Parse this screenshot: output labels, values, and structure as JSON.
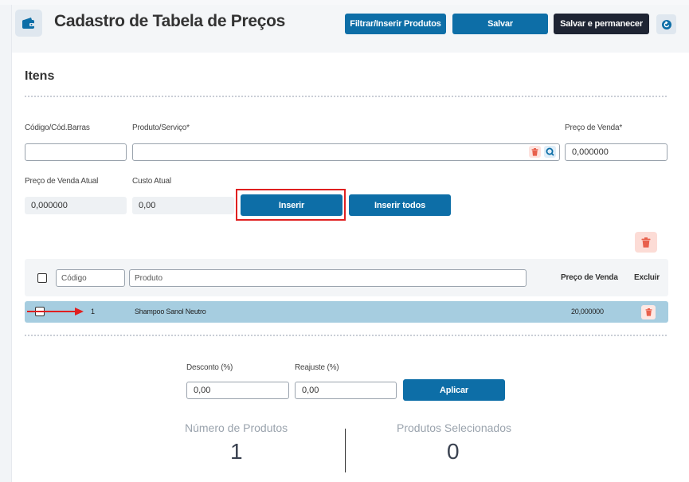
{
  "header": {
    "title": "Cadastro de Tabela de Preços",
    "buttons": {
      "filter": "Filtrar/Inserir Produtos",
      "save": "Salvar",
      "save_stay": "Salvar e permanecer"
    }
  },
  "items_section": {
    "title": "Itens",
    "fields": {
      "code_label": "Código/Cód.Barras",
      "code_value": "",
      "product_label": "Produto/Serviço*",
      "product_value": "",
      "sale_price_label": "Preço de Venda*",
      "sale_price_value": "0,000000",
      "current_sale_price_label": "Preço de Venda Atual",
      "current_sale_price_value": "0,000000",
      "current_cost_label": "Custo Atual",
      "current_cost_value": "0,00"
    },
    "buttons": {
      "insert": "Inserir",
      "insert_all": "Inserir todos"
    }
  },
  "table": {
    "filters": {
      "code_placeholder": "Código",
      "product_placeholder": "Produto"
    },
    "headers": {
      "sale_price": "Preço de Venda",
      "delete": "Excluir"
    },
    "rows": [
      {
        "code": "1",
        "product": "Shampoo Sanol Neutro",
        "price": "20,000000"
      }
    ]
  },
  "adjust": {
    "discount_label": "Desconto (%)",
    "discount_value": "0,00",
    "readjust_label": "Reajuste (%)",
    "readjust_value": "0,00",
    "apply_button": "Aplicar"
  },
  "stats": {
    "products_count_label": "Número de Produtos",
    "products_count_value": "1",
    "selected_label": "Produtos Selecionados",
    "selected_value": "0"
  },
  "colors": {
    "primary": "#0d6ea7",
    "dark": "#1e2433",
    "row_selected": "#a6cde0",
    "danger": "#e8604c",
    "annotation": "#e02020"
  },
  "icons": {
    "module": "wallet-icon",
    "back": "back-arrow-icon",
    "clear": "trash-icon",
    "search": "search-icon"
  }
}
